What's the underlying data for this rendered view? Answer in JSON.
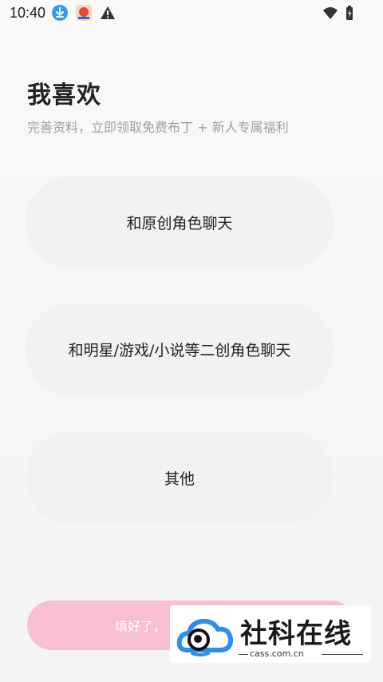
{
  "status_bar": {
    "time": "10:40",
    "icons": [
      "download-icon",
      "app-icon",
      "warning-icon",
      "wifi-icon",
      "battery-icon"
    ]
  },
  "header": {
    "title": "我喜欢",
    "subtitle": "完善资料，立即领取免费布丁 + 新人专属福利"
  },
  "options": [
    {
      "label": "和原创角色聊天"
    },
    {
      "label": "和明星/游戏/小说等二创角色聊天"
    },
    {
      "label": "其他"
    }
  ],
  "submit": {
    "label": "填好了，"
  },
  "watermark": {
    "brand": "社科在线",
    "url": "cass.com.cn"
  },
  "colors": {
    "accent_pink": "#f7bfd0",
    "option_bg": "#f2f2f4",
    "download_blue": "#2f9bf0"
  }
}
